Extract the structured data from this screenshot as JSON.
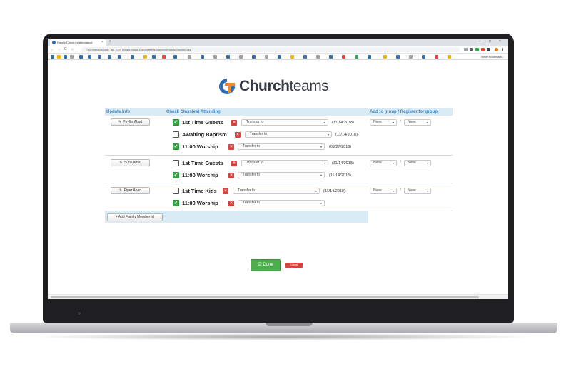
{
  "browser": {
    "tab_title": "Family Check-in/attendance",
    "tab_close": "×",
    "new_tab": "+",
    "minimize": "–",
    "maximize": "□",
    "close": "×",
    "back": "←",
    "forward": "→",
    "reload": "C",
    "home": "⌂",
    "url": "Churchteams.com, Inc. [US] | https://www.churchteams.com/cm/FamilyCheckIn.asp",
    "other_bookmarks": "Other bookmarks"
  },
  "logo": {
    "brand_prefix": "Church",
    "brand_suffix": "teams",
    "mark_color": "#2d6db5",
    "mark_accent": "#f08a24"
  },
  "table": {
    "headers": {
      "update_info": "Update Info",
      "check_classes": "Check Class(es) Attending",
      "add_to_group": "Add to group / Register for group"
    },
    "header_color": "#3d86c6",
    "header_bg": "#d9ecf6"
  },
  "families": [
    {
      "person": "Phyllis Abad",
      "classes": [
        {
          "name": "1st Time Guests",
          "checked": true,
          "transfer": "Transfer to",
          "date": "(11/14/2018)"
        },
        {
          "name": "Awaiting Baptism",
          "checked": false,
          "transfer": "Transfer to",
          "date": "(11/14/2018)"
        },
        {
          "name": "11:00 Worship",
          "checked": true,
          "transfer": "Transfer to",
          "date": "(09/27/2018)"
        }
      ],
      "group": {
        "add": "None",
        "register": "None",
        "slash": "/"
      }
    },
    {
      "person": "Sunil Abad",
      "classes": [
        {
          "name": "1st Time Guests",
          "checked": false,
          "transfer": "Transfer to",
          "date": "(11/14/2018)"
        },
        {
          "name": "11:00 Worship",
          "checked": true,
          "transfer": "Transfer to",
          "date": "(11/14/2018)"
        }
      ],
      "group": {
        "add": "None",
        "register": "None",
        "slash": "/"
      }
    },
    {
      "person": "Piper Abad",
      "classes": [
        {
          "name": "1st Time Kids",
          "checked": false,
          "transfer": "Transfer to",
          "date": "(11/14/2018)"
        },
        {
          "name": "11:00 Worship",
          "checked": true,
          "transfer": "Transfer to",
          "date": ""
        }
      ],
      "group": {
        "add": "None",
        "register": "None",
        "slash": "/"
      }
    }
  ],
  "icons": {
    "edit": "✎",
    "check": "✓",
    "remove": "×",
    "caret": "▾",
    "plus": "+"
  },
  "add_family_member": "Add Family Member(s)",
  "done_label": "Done",
  "cancel_label": "Cancel",
  "colors": {
    "done": "#4cae4c",
    "cancel": "#d9413d",
    "checked": "#3ba54a"
  }
}
